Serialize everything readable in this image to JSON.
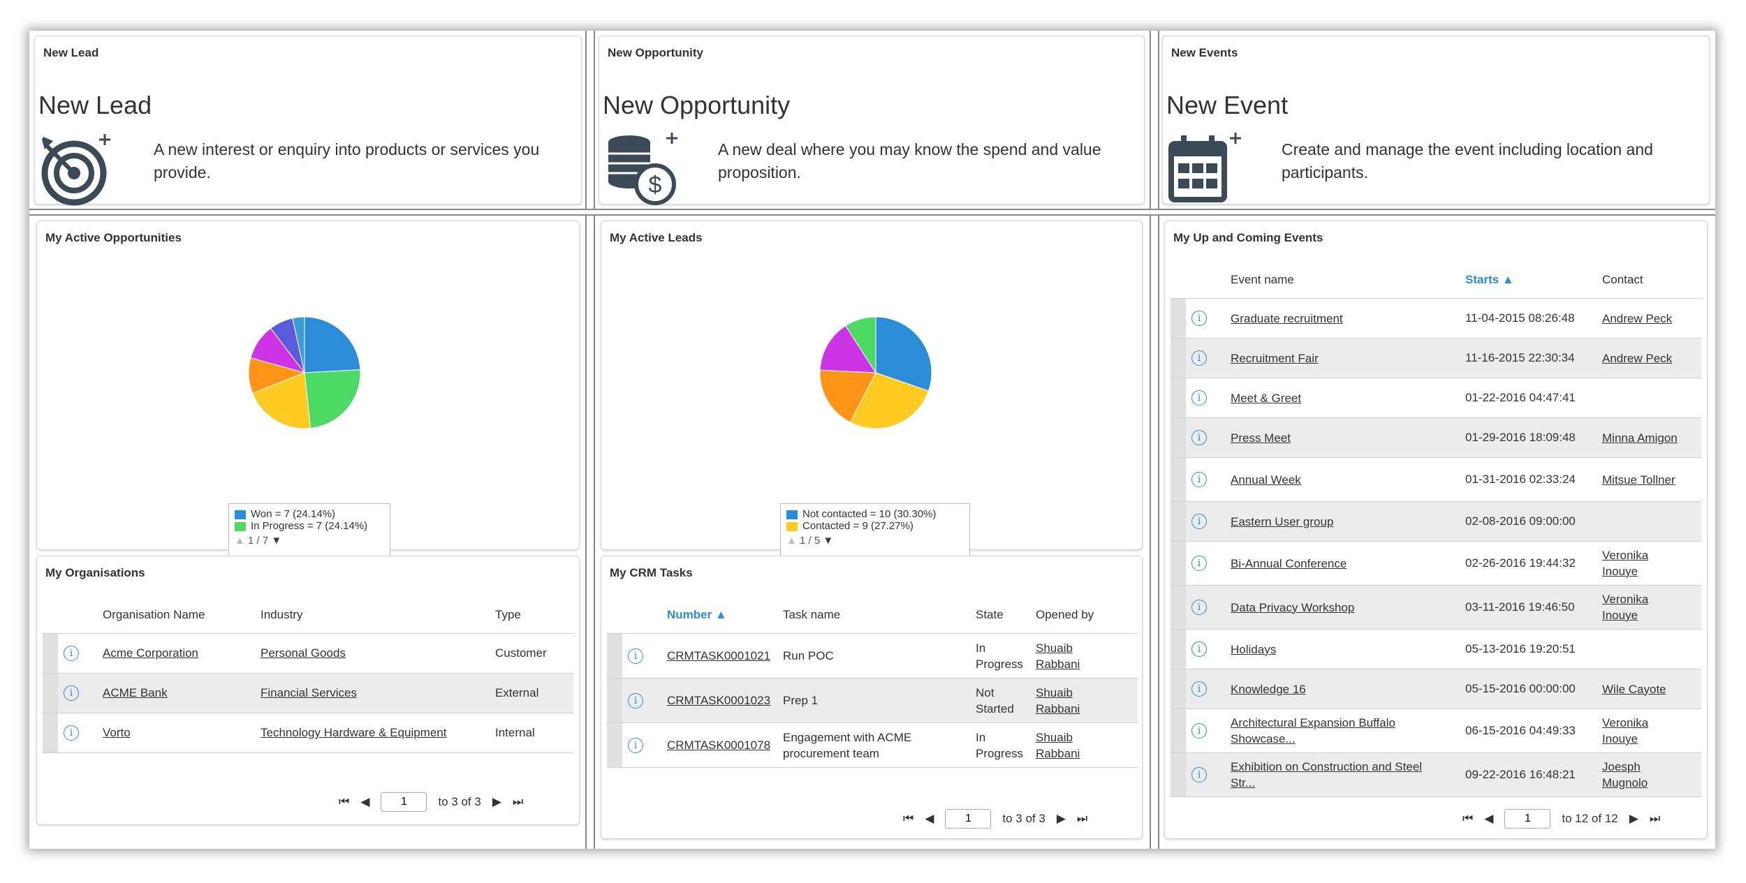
{
  "cards": {
    "new_lead": {
      "title": "New Lead",
      "heading": "New Lead",
      "desc": "A new interest or enquiry into products or services you provide.",
      "icon": "target-add-icon"
    },
    "new_opportunity": {
      "title": "New Opportunity",
      "heading": "New Opportunity",
      "desc": "A new deal where you may know the spend and value proposition.",
      "icon": "coins-add-icon"
    },
    "new_events": {
      "title": "New Events",
      "heading": "New Event",
      "desc": "Create and manage the event including location and participants.",
      "icon": "calendar-add-icon"
    }
  },
  "active_opportunities": {
    "title": "My Active Opportunities",
    "legend": [
      "Won = 7 (24.14%)",
      "In Progress = 7 (24.14%)"
    ],
    "legend_page": "1 / 7",
    "slices": [
      {
        "value": 24.14,
        "color": "#2b8cd8"
      },
      {
        "value": 24.14,
        "color": "#4cd964"
      },
      {
        "value": 20.69,
        "color": "#ffcb21"
      },
      {
        "value": 10.34,
        "color": "#ff9419"
      },
      {
        "value": 10.34,
        "color": "#cc34e6"
      },
      {
        "value": 6.9,
        "color": "#5a5adc"
      },
      {
        "value": 3.45,
        "color": "#3d9ad6"
      }
    ]
  },
  "active_leads": {
    "title": "My Active Leads",
    "legend": [
      "Not contacted = 10 (30.30%)",
      "Contacted = 9 (27.27%)"
    ],
    "legend_page": "1 / 5",
    "slices": [
      {
        "value": 30.3,
        "color": "#2b8cd8"
      },
      {
        "value": 27.27,
        "color": "#ffcb21"
      },
      {
        "value": 18.18,
        "color": "#ff9419"
      },
      {
        "value": 15.15,
        "color": "#cc34e6"
      },
      {
        "value": 9.1,
        "color": "#4cd964"
      }
    ]
  },
  "organisations": {
    "title": "My Organisations",
    "columns": [
      "Organisation Name",
      "Industry",
      "Type"
    ],
    "rows": [
      {
        "name": "Acme Corporation",
        "industry": "Personal Goods",
        "type": "Customer"
      },
      {
        "name": "ACME Bank",
        "industry": "Financial Services",
        "type": "External"
      },
      {
        "name": "Vorto",
        "industry": "Technology Hardware & Equipment",
        "type": "Internal"
      }
    ],
    "pager": {
      "page": "1",
      "of": "to 3 of 3"
    }
  },
  "tasks": {
    "title": "My CRM Tasks",
    "columns": [
      "Number",
      "Task name",
      "State",
      "Opened by"
    ],
    "sort_indicator": "▲",
    "rows": [
      {
        "number": "CRMTASK0001021",
        "task": "Run POC",
        "state": "In Progress",
        "opened_by": "Shuaib Rabbani"
      },
      {
        "number": "CRMTASK0001023",
        "task": "Prep 1",
        "state": "Not Started",
        "opened_by": "Shuaib Rabbani"
      },
      {
        "number": "CRMTASK0001078",
        "task": "Engagement with ACME procurement team",
        "state": "In Progress",
        "opened_by": "Shuaib Rabbani"
      }
    ],
    "pager": {
      "page": "1",
      "of": "to 3 of 3"
    }
  },
  "events": {
    "title": "My Up and Coming Events",
    "columns": [
      "Event name",
      "Starts",
      "Contact"
    ],
    "sort_indicator": "▲",
    "rows": [
      {
        "name": "Graduate recruitment",
        "starts": "11-04-2015 08:26:48",
        "contact": "Andrew Peck"
      },
      {
        "name": "Recruitment Fair",
        "starts": "11-16-2015 22:30:34",
        "contact": "Andrew Peck"
      },
      {
        "name": "Meet & Greet",
        "starts": "01-22-2016 04:47:41",
        "contact": ""
      },
      {
        "name": "Press Meet",
        "starts": "01-29-2016 18:09:48",
        "contact": "Minna Amigon"
      },
      {
        "name": "Annual Week",
        "starts": "01-31-2016 02:33:24",
        "contact": "Mitsue Tollner"
      },
      {
        "name": "Eastern User group",
        "starts": "02-08-2016 09:00:00",
        "contact": ""
      },
      {
        "name": "Bi-Annual Conference",
        "starts": "02-26-2016 19:44:32",
        "contact": "Veronika Inouye"
      },
      {
        "name": "Data Privacy Workshop",
        "starts": "03-11-2016 19:46:50",
        "contact": "Veronika Inouye"
      },
      {
        "name": "Holidays",
        "starts": "05-13-2016 19:20:51",
        "contact": ""
      },
      {
        "name": "Knowledge 16",
        "starts": "05-15-2016 00:00:00",
        "contact": "Wile Cayote"
      },
      {
        "name": "Architectural Expansion Buffalo Showcase...",
        "starts": "06-15-2016 04:49:33",
        "contact": "Veronika Inouye"
      },
      {
        "name": "Exhibition on Construction and Steel Str...",
        "starts": "09-22-2016 16:48:21",
        "contact": "Joesph Mugnolo"
      }
    ],
    "pager": {
      "page": "1",
      "of": "to 12 of 12"
    }
  },
  "pager_icons": {
    "first": "⏮",
    "prev": "◀",
    "next": "▶",
    "last": "⏭"
  },
  "info_icon": "i"
}
